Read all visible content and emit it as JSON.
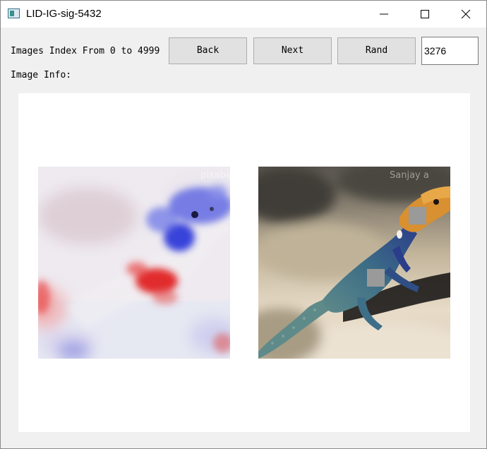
{
  "window": {
    "title": "LID-IG-sig-5432",
    "app_icon": "window-app-icon",
    "controls": [
      "minimize-icon",
      "maximize-icon",
      "close-icon"
    ]
  },
  "toolbar": {
    "index_label": "Images Index From 0 to 4999",
    "back_label": "Back",
    "next_label": "Next",
    "rand_label": "Rand",
    "index_value": "3276"
  },
  "info": {
    "label": "Image Info:"
  },
  "images": {
    "attribution_watermark": "pixabay",
    "photo_watermark": "Sanjay a"
  },
  "colors": {
    "positive_attribution": "#e01818",
    "negative_attribution": "#1830d8",
    "lizard_head": "#d89030",
    "occlusion_patch": "#9a9a9a"
  }
}
